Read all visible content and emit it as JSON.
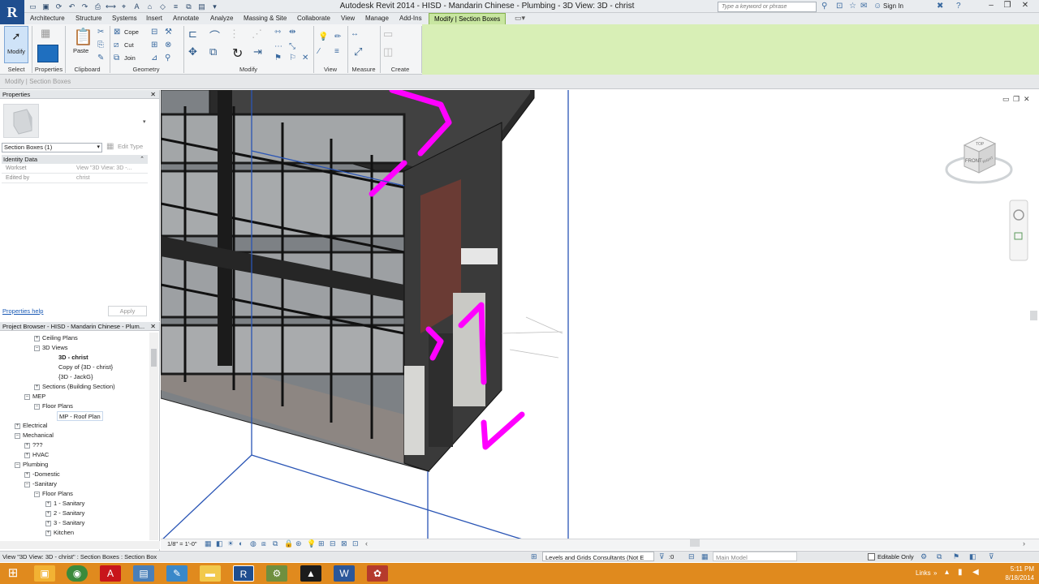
{
  "window": {
    "title": "Autodesk Revit 2014 -    HISD - Mandarin Chinese - Plumbing - 3D View: 3D - christ",
    "search_placeholder": "Type a keyword or phrase",
    "sign_in": "Sign In"
  },
  "tabs": [
    "Architecture",
    "Structure",
    "Systems",
    "Insert",
    "Annotate",
    "Analyze",
    "Massing & Site",
    "Collaborate",
    "View",
    "Manage",
    "Add-Ins",
    "Modify | Section Boxes"
  ],
  "ribbon": {
    "modify_label": "Modify",
    "paste_label": "Paste",
    "cope_label": "Cope",
    "cut_label": "Cut",
    "join_label": "Join",
    "panels": [
      "Select",
      "Properties",
      "Clipboard",
      "Geometry",
      "Modify",
      "View",
      "Measure",
      "Create"
    ]
  },
  "options_bar": {
    "context": "Modify | Section Boxes"
  },
  "properties": {
    "title": "Properties",
    "type_selector": "Section Boxes (1)",
    "edit_type": "Edit Type",
    "group": "Identity Data",
    "rows": [
      {
        "key": "Workset",
        "value": "View \"3D View: 3D -..."
      },
      {
        "key": "Edited by",
        "value": "christ"
      }
    ],
    "help": "Properties help",
    "apply": "Apply"
  },
  "browser": {
    "title": "Project Browser - HISD - Mandarin Chinese - Plum...",
    "items": [
      "Ceiling Plans",
      "3D Views",
      "3D - christ",
      "Copy of {3D - christ}",
      "{3D - JackG}",
      "Sections (Building Section)",
      "MEP",
      "Floor Plans",
      "MP - Roof Plan",
      "Electrical",
      "Mechanical",
      "???",
      "HVAC",
      "Plumbing",
      "-Domestic",
      "-Sanitary",
      "Floor Plans",
      "1 - Sanitary",
      "2 - Sanitary",
      "3 - Sanitary",
      "Kitchen"
    ]
  },
  "view_control": {
    "scale": "1/8\" = 1'-0\""
  },
  "viewcube": {
    "top": "TOP",
    "front": "FRONT",
    "right": "RIGHT"
  },
  "status": {
    "message": "View \"3D View: 3D - christ\" : Section Boxes : Section Box",
    "workset": "Levels and Grids Consultants (Not E",
    "count": ":0",
    "design_option": "Main Model",
    "editable_only": "Editable Only"
  },
  "taskbar": {
    "links": "Links",
    "time": "5:11 PM",
    "date": "8/18/2014"
  },
  "colors": {
    "ribbon_context": "#d8efb6",
    "pipe": "#ff00ff",
    "section_box": "#2a55b5",
    "taskbar": "#e08a1e"
  }
}
